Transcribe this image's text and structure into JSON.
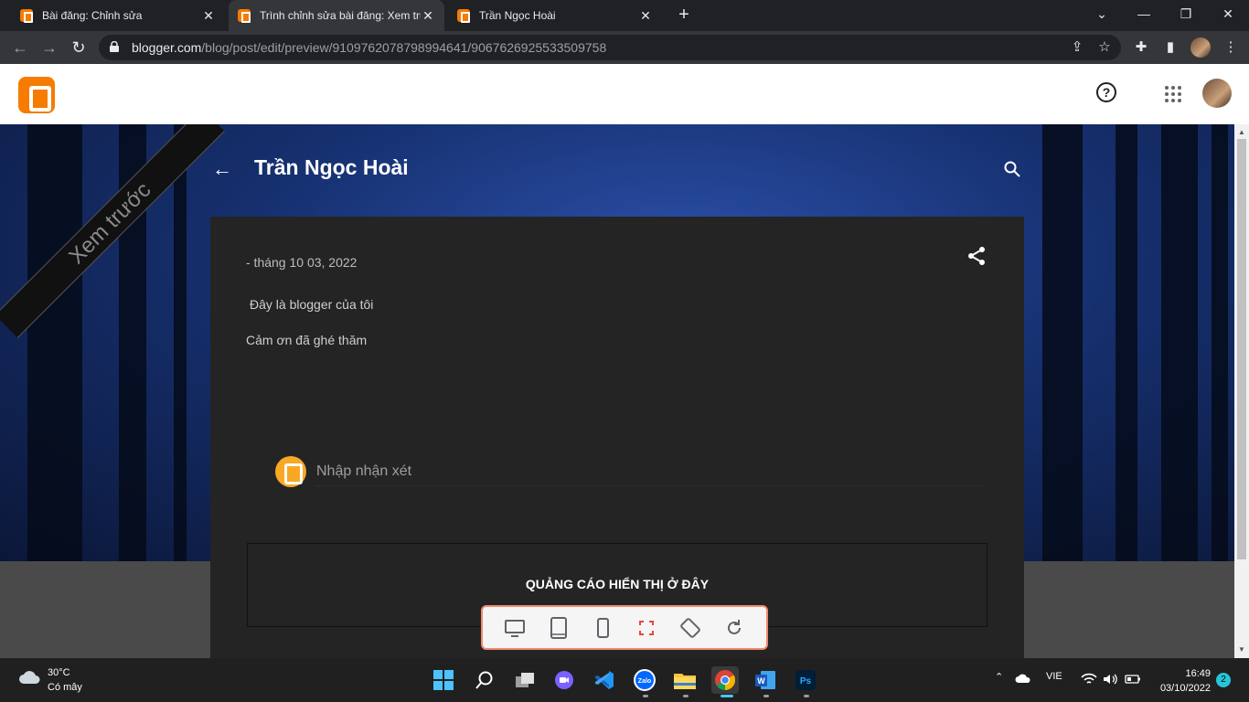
{
  "browser": {
    "tabs": [
      {
        "title": "Bài đăng: Chỉnh sửa"
      },
      {
        "title": "Trình chỉnh sửa bài đăng: Xem trước"
      },
      {
        "title": "Trần Ngọc Hoài"
      }
    ],
    "url_host": "blogger.com",
    "url_path": "/blog/post/edit/preview/9109762078798994641/9067626925533509758"
  },
  "preview": {
    "ribbon": "Xem trước",
    "blog_title": "Trần Ngọc Hoài",
    "post_date": "- tháng 10 03, 2022",
    "body_lines": [
      "Đây là blogger của tôi",
      "Cảm ơn đã ghé thăm"
    ],
    "comment_placeholder": "Nhập nhận xét",
    "ad_text": "QUẢNG CÁO HIỂN THỊ Ở ĐÂY"
  },
  "device_toolbar": {
    "icons": [
      "desktop-icon",
      "tablet-icon",
      "phone-icon",
      "fullscreen-icon",
      "rotate-icon",
      "refresh-icon"
    ]
  },
  "taskbar": {
    "temperature": "30°C",
    "condition": "Có mây",
    "language": "VIE",
    "time": "16:49",
    "date": "03/10/2022",
    "notifications": "2"
  },
  "colors": {
    "blogger_orange": "#f57c00",
    "device_bar_border": "#f08a6c"
  }
}
